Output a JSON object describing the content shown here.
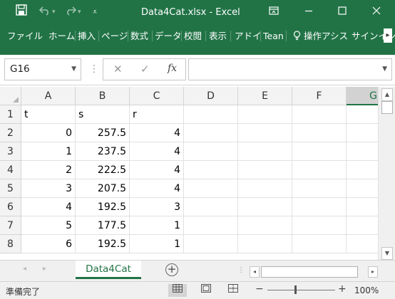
{
  "window": {
    "title": "Data4Cat.xlsx - Excel",
    "qa_icons": [
      "save-icon",
      "undo-icon",
      "redo-icon",
      "customize-icon"
    ],
    "controls": [
      "ribbon-display-icon",
      "minimize-icon",
      "maximize-icon",
      "close-icon"
    ]
  },
  "ribbon": {
    "tabs": [
      "ファイル",
      "ホーム",
      "挿入",
      "ページ",
      "数式",
      "データ",
      "校閲",
      "表示",
      "アドイ",
      "Tean",
      "操作アシス",
      "サインイン"
    ],
    "scroll_glyph": "▸"
  },
  "formula_bar": {
    "name_box": "G16",
    "cancel_glyph": "✕",
    "enter_glyph": "✓",
    "fx_glyph": "fx",
    "formula": ""
  },
  "grid": {
    "columns": [
      "A",
      "B",
      "C",
      "D",
      "E",
      "F",
      "G"
    ],
    "selected_column": "G",
    "rows": [
      {
        "num": "1",
        "cells": [
          {
            "v": "t",
            "t": "s"
          },
          {
            "v": "s",
            "t": "s"
          },
          {
            "v": "r",
            "t": "s"
          },
          {
            "v": "",
            "t": "s"
          },
          {
            "v": "",
            "t": "s"
          },
          {
            "v": "",
            "t": "s"
          },
          {
            "v": "",
            "t": "s"
          }
        ]
      },
      {
        "num": "2",
        "cells": [
          {
            "v": "0",
            "t": "n"
          },
          {
            "v": "257.5",
            "t": "n"
          },
          {
            "v": "4",
            "t": "n"
          },
          {
            "v": "",
            "t": "s"
          },
          {
            "v": "",
            "t": "s"
          },
          {
            "v": "",
            "t": "s"
          },
          {
            "v": "",
            "t": "s"
          }
        ]
      },
      {
        "num": "3",
        "cells": [
          {
            "v": "1",
            "t": "n"
          },
          {
            "v": "237.5",
            "t": "n"
          },
          {
            "v": "4",
            "t": "n"
          },
          {
            "v": "",
            "t": "s"
          },
          {
            "v": "",
            "t": "s"
          },
          {
            "v": "",
            "t": "s"
          },
          {
            "v": "",
            "t": "s"
          }
        ]
      },
      {
        "num": "4",
        "cells": [
          {
            "v": "2",
            "t": "n"
          },
          {
            "v": "222.5",
            "t": "n"
          },
          {
            "v": "4",
            "t": "n"
          },
          {
            "v": "",
            "t": "s"
          },
          {
            "v": "",
            "t": "s"
          },
          {
            "v": "",
            "t": "s"
          },
          {
            "v": "",
            "t": "s"
          }
        ]
      },
      {
        "num": "5",
        "cells": [
          {
            "v": "3",
            "t": "n"
          },
          {
            "v": "207.5",
            "t": "n"
          },
          {
            "v": "4",
            "t": "n"
          },
          {
            "v": "",
            "t": "s"
          },
          {
            "v": "",
            "t": "s"
          },
          {
            "v": "",
            "t": "s"
          },
          {
            "v": "",
            "t": "s"
          }
        ]
      },
      {
        "num": "6",
        "cells": [
          {
            "v": "4",
            "t": "n"
          },
          {
            "v": "192.5",
            "t": "n"
          },
          {
            "v": "3",
            "t": "n"
          },
          {
            "v": "",
            "t": "s"
          },
          {
            "v": "",
            "t": "s"
          },
          {
            "v": "",
            "t": "s"
          },
          {
            "v": "",
            "t": "s"
          }
        ]
      },
      {
        "num": "7",
        "cells": [
          {
            "v": "5",
            "t": "n"
          },
          {
            "v": "177.5",
            "t": "n"
          },
          {
            "v": "1",
            "t": "n"
          },
          {
            "v": "",
            "t": "s"
          },
          {
            "v": "",
            "t": "s"
          },
          {
            "v": "",
            "t": "s"
          },
          {
            "v": "",
            "t": "s"
          }
        ]
      },
      {
        "num": "8",
        "cells": [
          {
            "v": "6",
            "t": "n"
          },
          {
            "v": "192.5",
            "t": "n"
          },
          {
            "v": "1",
            "t": "n"
          },
          {
            "v": "",
            "t": "s"
          },
          {
            "v": "",
            "t": "s"
          },
          {
            "v": "",
            "t": "s"
          },
          {
            "v": "",
            "t": "s"
          }
        ]
      }
    ]
  },
  "sheets": {
    "tabs": [
      "Data4Cat"
    ],
    "active": "Data4Cat",
    "add_glyph": "+"
  },
  "status": {
    "ready": "準備完了",
    "zoom_minus": "−",
    "zoom_plus": "+",
    "zoom": "100%"
  },
  "colors": {
    "accent": "#217346",
    "header_bg": "#f3f3f3",
    "gridline": "#e1e1e1"
  }
}
